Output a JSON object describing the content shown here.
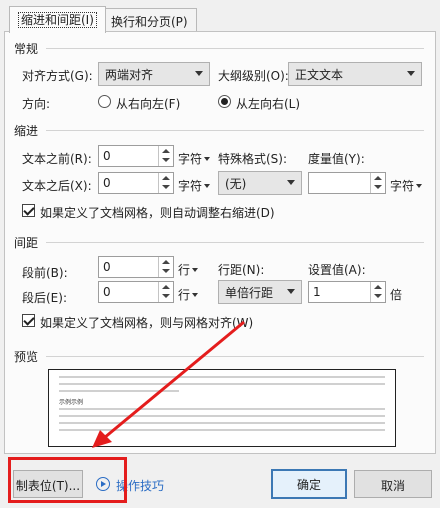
{
  "tabs": [
    {
      "label": "缩进和间距(I)",
      "active": true
    },
    {
      "label": "换行和分页(P)",
      "active": false
    }
  ],
  "general": {
    "title": "常规",
    "alignment_label": "对齐方式(G):",
    "alignment_value": "两端对齐",
    "outline_label": "大纲级别(O):",
    "outline_value": "正文文本",
    "direction_label": "方向:",
    "rtl_label": "从右向左(F)",
    "ltr_label": "从左向右(L)",
    "direction_selected": "ltr"
  },
  "indent": {
    "title": "缩进",
    "before_label": "文本之前(R):",
    "before_value": "0",
    "before_unit": "字符",
    "after_label": "文本之后(X):",
    "after_value": "0",
    "after_unit": "字符",
    "special_label": "特殊格式(S):",
    "special_value": "(无)",
    "measure_label": "度量值(Y):",
    "measure_value": "",
    "measure_unit": "字符",
    "auto_adjust_label": "如果定义了文档网格，则自动调整右缩进(D)",
    "auto_adjust_checked": true
  },
  "spacing": {
    "title": "间距",
    "before_label": "段前(B):",
    "before_value": "0",
    "before_unit": "行",
    "after_label": "段后(E):",
    "after_value": "0",
    "after_unit": "行",
    "line_label": "行距(N):",
    "line_value": "单倍行距",
    "setting_label": "设置值(A):",
    "setting_value": "1",
    "setting_unit": "倍",
    "grid_label": "如果定义了文档网格，则与网格对齐(W)",
    "grid_checked": true
  },
  "preview": {
    "title": "预览",
    "current_text": "示例示例"
  },
  "footer": {
    "tabs_button": "制表位(T)...",
    "tips_link": "操作技巧",
    "ok_button": "确定",
    "cancel_button": "取消"
  },
  "colors": {
    "highlight": "#e41d1d",
    "link": "#2a6cc4",
    "default_button_border": "#3c78b4"
  }
}
